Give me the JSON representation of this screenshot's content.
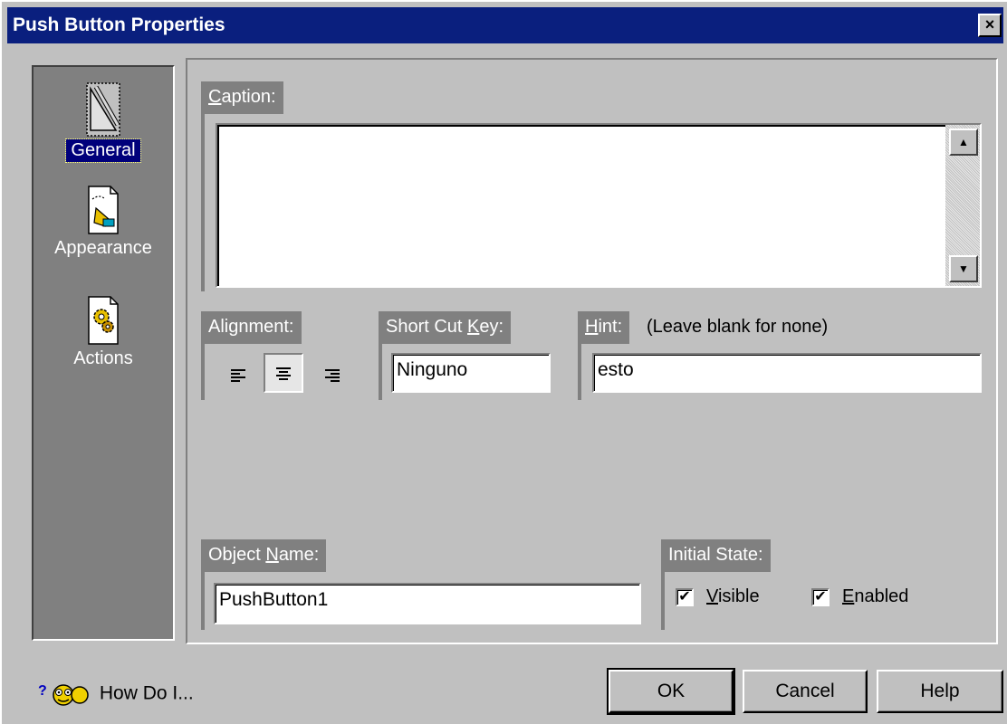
{
  "window": {
    "title": "Push Button Properties",
    "close_glyph": "×"
  },
  "nav": {
    "items": [
      {
        "label": "General",
        "icon": "ruler-pencil-icon",
        "selected": true
      },
      {
        "label": "Appearance",
        "icon": "paint-brush-icon",
        "selected": false
      },
      {
        "label": "Actions",
        "icon": "gears-icon",
        "selected": false
      }
    ]
  },
  "caption": {
    "label_mnemonic": "C",
    "label_rest": "aption:",
    "value": ""
  },
  "alignment": {
    "label": "Alignment:",
    "options": [
      "left",
      "center",
      "right"
    ],
    "selected": "center"
  },
  "shortcut": {
    "label_pre": "Short Cut ",
    "label_mnemonic": "K",
    "label_post": "ey:",
    "value": "Ninguno"
  },
  "hint": {
    "label_mnemonic": "H",
    "label_rest": "int:",
    "note": "(Leave blank for none)",
    "value": "esto"
  },
  "object_name": {
    "label_pre": "Object ",
    "label_mnemonic": "N",
    "label_post": "ame:",
    "value": "PushButton1"
  },
  "initial_state": {
    "label": "Initial State:",
    "visible": {
      "mnemonic": "V",
      "rest": "isible",
      "checked": true
    },
    "enabled": {
      "mnemonic": "E",
      "rest": "nabled",
      "checked": true
    }
  },
  "footer": {
    "how_do_i": "How Do I...",
    "ok": "OK",
    "cancel": "Cancel",
    "help": "Help"
  },
  "colors": {
    "titlebar": "#0a1f7e",
    "dialog_bg": "#c0c0c0",
    "nav_bg": "#808080",
    "selection": "#00007b"
  }
}
